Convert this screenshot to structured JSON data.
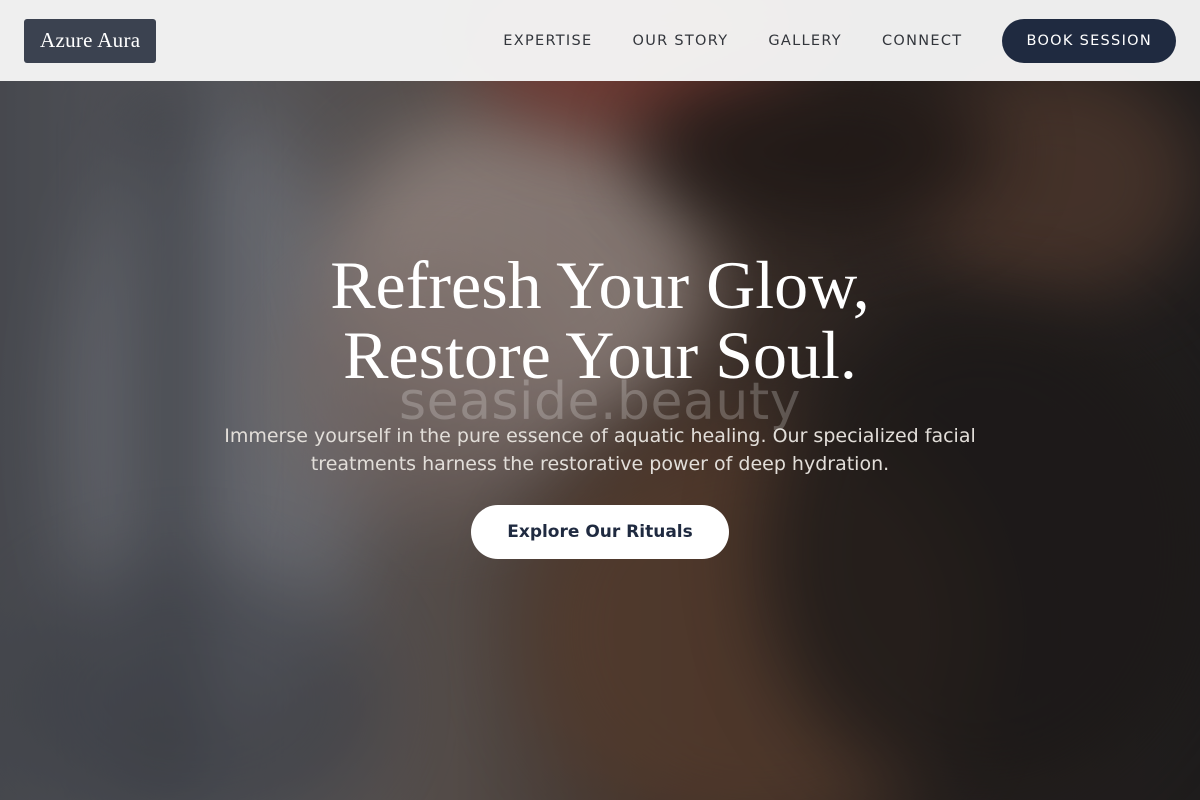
{
  "header": {
    "logo_text": "Azure Aura",
    "nav": [
      {
        "label": "EXPERTISE"
      },
      {
        "label": "OUR STORY"
      },
      {
        "label": "GALLERY"
      },
      {
        "label": "CONNECT"
      }
    ],
    "book_button": "BOOK SESSION"
  },
  "hero": {
    "headline_line1": "Refresh Your Glow,",
    "headline_line2": "Restore Your Soul.",
    "watermark": "seaside.beauty",
    "subtext_line1": "Immerse yourself in the pure essence of aquatic healing. Our specialized facial",
    "subtext_line2": "treatments harness the restorative power of deep hydration.",
    "cta_label": "Explore Our Rituals"
  },
  "colors": {
    "header_bg": "#f6f6f6",
    "logo_bg": "#3b4250",
    "accent_navy": "#1f2a40",
    "hero_text": "#ffffff"
  }
}
